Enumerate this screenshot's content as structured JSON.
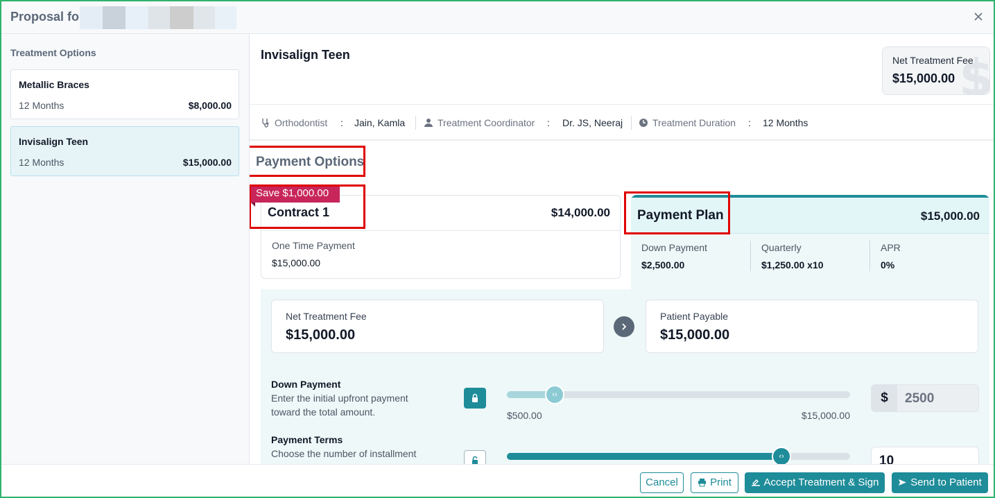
{
  "header": {
    "title": "Proposal for"
  },
  "sidebar": {
    "heading": "Treatment Options",
    "options": [
      {
        "name": "Metallic Braces",
        "duration": "12 Months",
        "price": "$8,000.00"
      },
      {
        "name": "Invisalign Teen",
        "duration": "12 Months",
        "price": "$15,000.00"
      }
    ]
  },
  "treatment": {
    "title": "Invisalign Teen",
    "fee_label": "Net Treatment Fee",
    "fee_value": "$15,000.00",
    "fee_watermark": "$",
    "info": {
      "orthodontist_label": "Orthodontist",
      "orthodontist_value": "Jain, Kamla",
      "coordinator_label": "Treatment Coordinator",
      "coordinator_value": "Dr. JS, Neeraj",
      "duration_label": "Treatment Duration",
      "duration_value": "12 Months",
      "separator": ":"
    }
  },
  "payment": {
    "section_title": "Payment Options",
    "contract": {
      "badge": "Save $1,000.00",
      "name": "Contract 1",
      "price": "$14,000.00",
      "sub_label": "One Time Payment",
      "sub_value": "$15,000.00"
    },
    "plan": {
      "name": "Payment Plan",
      "price": "$15,000.00",
      "columns": [
        {
          "label": "Down Payment",
          "value": "$2,500.00"
        },
        {
          "label": "Quarterly",
          "value": "$1,250.00 x10"
        },
        {
          "label": "APR",
          "value": "0%"
        }
      ]
    },
    "summary": {
      "net_label": "Net Treatment Fee",
      "net_value": "$15,000.00",
      "payable_label": "Patient Payable",
      "payable_value": "$15,000.00"
    },
    "down_payment": {
      "title": "Down Payment",
      "desc": "Enter the initial upfront payment toward the total amount.",
      "min": "$500.00",
      "max": "$15,000.00",
      "currency": "$",
      "value": "2500",
      "level": 0.14
    },
    "terms": {
      "title": "Payment Terms",
      "desc": "Choose the number of installment",
      "value": "10",
      "level": 0.8
    }
  },
  "footer": {
    "cancel": "Cancel",
    "print": "Print",
    "accept": "Accept Treatment & Sign",
    "send": "Send to Patient"
  },
  "colors": {
    "accent": "#1e8c99",
    "badge": "#c8265a",
    "highlight_box": "#e00000",
    "frame": "#2fb36d"
  }
}
